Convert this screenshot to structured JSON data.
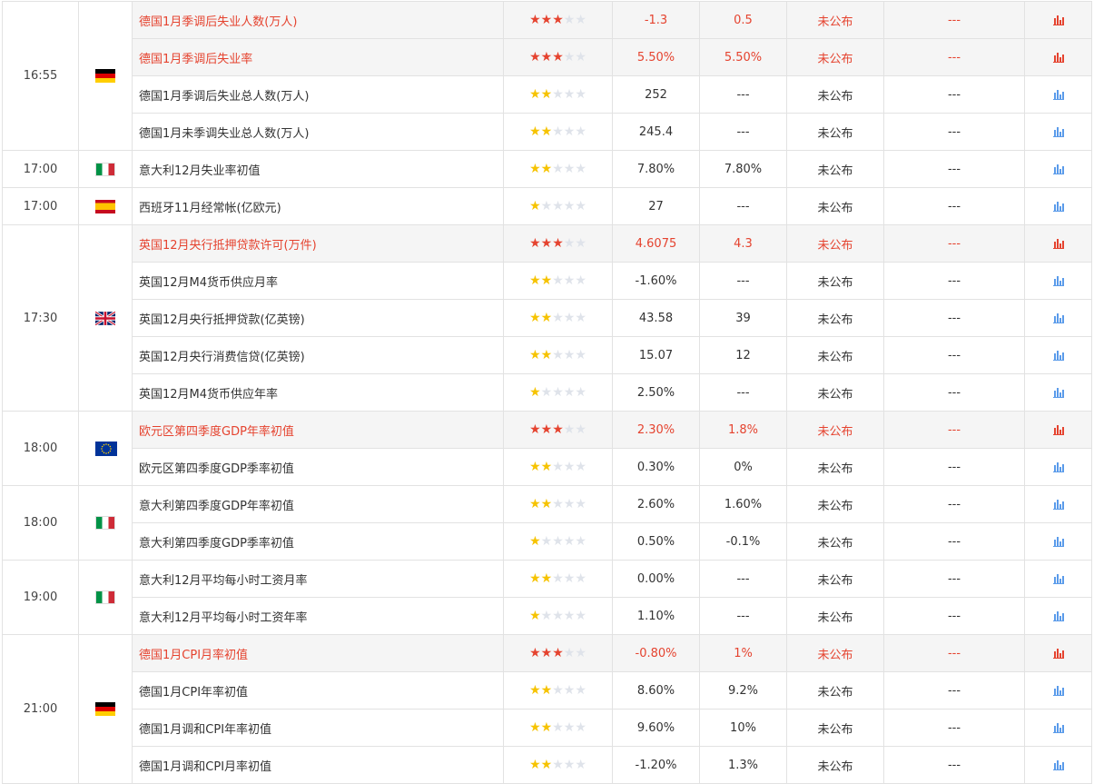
{
  "colors": {
    "highlight_text": "#e5432f",
    "highlight_bg": "#f5f5f5",
    "star_high": "#e5432f",
    "star_normal": "#f6c300",
    "star_off": "#dfe3ea",
    "chart_icon_high": "#e5432f",
    "chart_icon_normal": "#5a9bea"
  },
  "groups": [
    {
      "time": "16:55",
      "country": "germany",
      "flag_icon": "flag-de",
      "events": [
        {
          "name": "德国1月季调后失业人数(万人)",
          "stars": 3,
          "previous": "-1.3",
          "forecast": "0.5",
          "actual": "未公布",
          "impact": "---",
          "highlight": true
        },
        {
          "name": "德国1月季调后失业率",
          "stars": 3,
          "previous": "5.50%",
          "forecast": "5.50%",
          "actual": "未公布",
          "impact": "---",
          "highlight": true
        },
        {
          "name": "德国1月季调后失业总人数(万人)",
          "stars": 2,
          "previous": "252",
          "forecast": "---",
          "actual": "未公布",
          "impact": "---",
          "highlight": false
        },
        {
          "name": "德国1月未季调失业总人数(万人)",
          "stars": 2,
          "previous": "245.4",
          "forecast": "---",
          "actual": "未公布",
          "impact": "---",
          "highlight": false
        }
      ]
    },
    {
      "time": "17:00",
      "country": "italy",
      "flag_icon": "flag-it",
      "events": [
        {
          "name": "意大利12月失业率初值",
          "stars": 2,
          "previous": "7.80%",
          "forecast": "7.80%",
          "actual": "未公布",
          "impact": "---",
          "highlight": false
        }
      ]
    },
    {
      "time": "17:00",
      "country": "spain",
      "flag_icon": "flag-es",
      "events": [
        {
          "name": "西班牙11月经常帐(亿欧元)",
          "stars": 1,
          "previous": "27",
          "forecast": "---",
          "actual": "未公布",
          "impact": "---",
          "highlight": false
        }
      ]
    },
    {
      "time": "17:30",
      "country": "uk",
      "flag_icon": "flag-gb",
      "events": [
        {
          "name": "英国12月央行抵押贷款许可(万件)",
          "stars": 3,
          "previous": "4.6075",
          "forecast": "4.3",
          "actual": "未公布",
          "impact": "---",
          "highlight": true
        },
        {
          "name": "英国12月M4货币供应月率",
          "stars": 2,
          "previous": "-1.60%",
          "forecast": "---",
          "actual": "未公布",
          "impact": "---",
          "highlight": false
        },
        {
          "name": "英国12月央行抵押贷款(亿英镑)",
          "stars": 2,
          "previous": "43.58",
          "forecast": "39",
          "actual": "未公布",
          "impact": "---",
          "highlight": false
        },
        {
          "name": "英国12月央行消费信贷(亿英镑)",
          "stars": 2,
          "previous": "15.07",
          "forecast": "12",
          "actual": "未公布",
          "impact": "---",
          "highlight": false
        },
        {
          "name": "英国12月M4货币供应年率",
          "stars": 1,
          "previous": "2.50%",
          "forecast": "---",
          "actual": "未公布",
          "impact": "---",
          "highlight": false
        }
      ]
    },
    {
      "time": "18:00",
      "country": "eurozone",
      "flag_icon": "flag-eu",
      "events": [
        {
          "name": "欧元区第四季度GDP年率初值",
          "stars": 3,
          "previous": "2.30%",
          "forecast": "1.8%",
          "actual": "未公布",
          "impact": "---",
          "highlight": true
        },
        {
          "name": "欧元区第四季度GDP季率初值",
          "stars": 2,
          "previous": "0.30%",
          "forecast": "0%",
          "actual": "未公布",
          "impact": "---",
          "highlight": false
        }
      ]
    },
    {
      "time": "18:00",
      "country": "italy",
      "flag_icon": "flag-it",
      "events": [
        {
          "name": "意大利第四季度GDP年率初值",
          "stars": 2,
          "previous": "2.60%",
          "forecast": "1.60%",
          "actual": "未公布",
          "impact": "---",
          "highlight": false
        },
        {
          "name": "意大利第四季度GDP季率初值",
          "stars": 1,
          "previous": "0.50%",
          "forecast": "-0.1%",
          "actual": "未公布",
          "impact": "---",
          "highlight": false
        }
      ]
    },
    {
      "time": "19:00",
      "country": "italy",
      "flag_icon": "flag-it",
      "events": [
        {
          "name": "意大利12月平均每小时工资月率",
          "stars": 2,
          "previous": "0.00%",
          "forecast": "---",
          "actual": "未公布",
          "impact": "---",
          "highlight": false
        },
        {
          "name": "意大利12月平均每小时工资年率",
          "stars": 1,
          "previous": "1.10%",
          "forecast": "---",
          "actual": "未公布",
          "impact": "---",
          "highlight": false
        }
      ]
    },
    {
      "time": "21:00",
      "country": "germany",
      "flag_icon": "flag-de",
      "events": [
        {
          "name": "德国1月CPI月率初值",
          "stars": 3,
          "previous": "-0.80%",
          "forecast": "1%",
          "actual": "未公布",
          "impact": "---",
          "highlight": true
        },
        {
          "name": "德国1月CPI年率初值",
          "stars": 2,
          "previous": "8.60%",
          "forecast": "9.2%",
          "actual": "未公布",
          "impact": "---",
          "highlight": false
        },
        {
          "name": "德国1月调和CPI年率初值",
          "stars": 2,
          "previous": "9.60%",
          "forecast": "10%",
          "actual": "未公布",
          "impact": "---",
          "highlight": false
        },
        {
          "name": "德国1月调和CPI月率初值",
          "stars": 2,
          "previous": "-1.20%",
          "forecast": "1.3%",
          "actual": "未公布",
          "impact": "---",
          "highlight": false
        }
      ]
    }
  ]
}
